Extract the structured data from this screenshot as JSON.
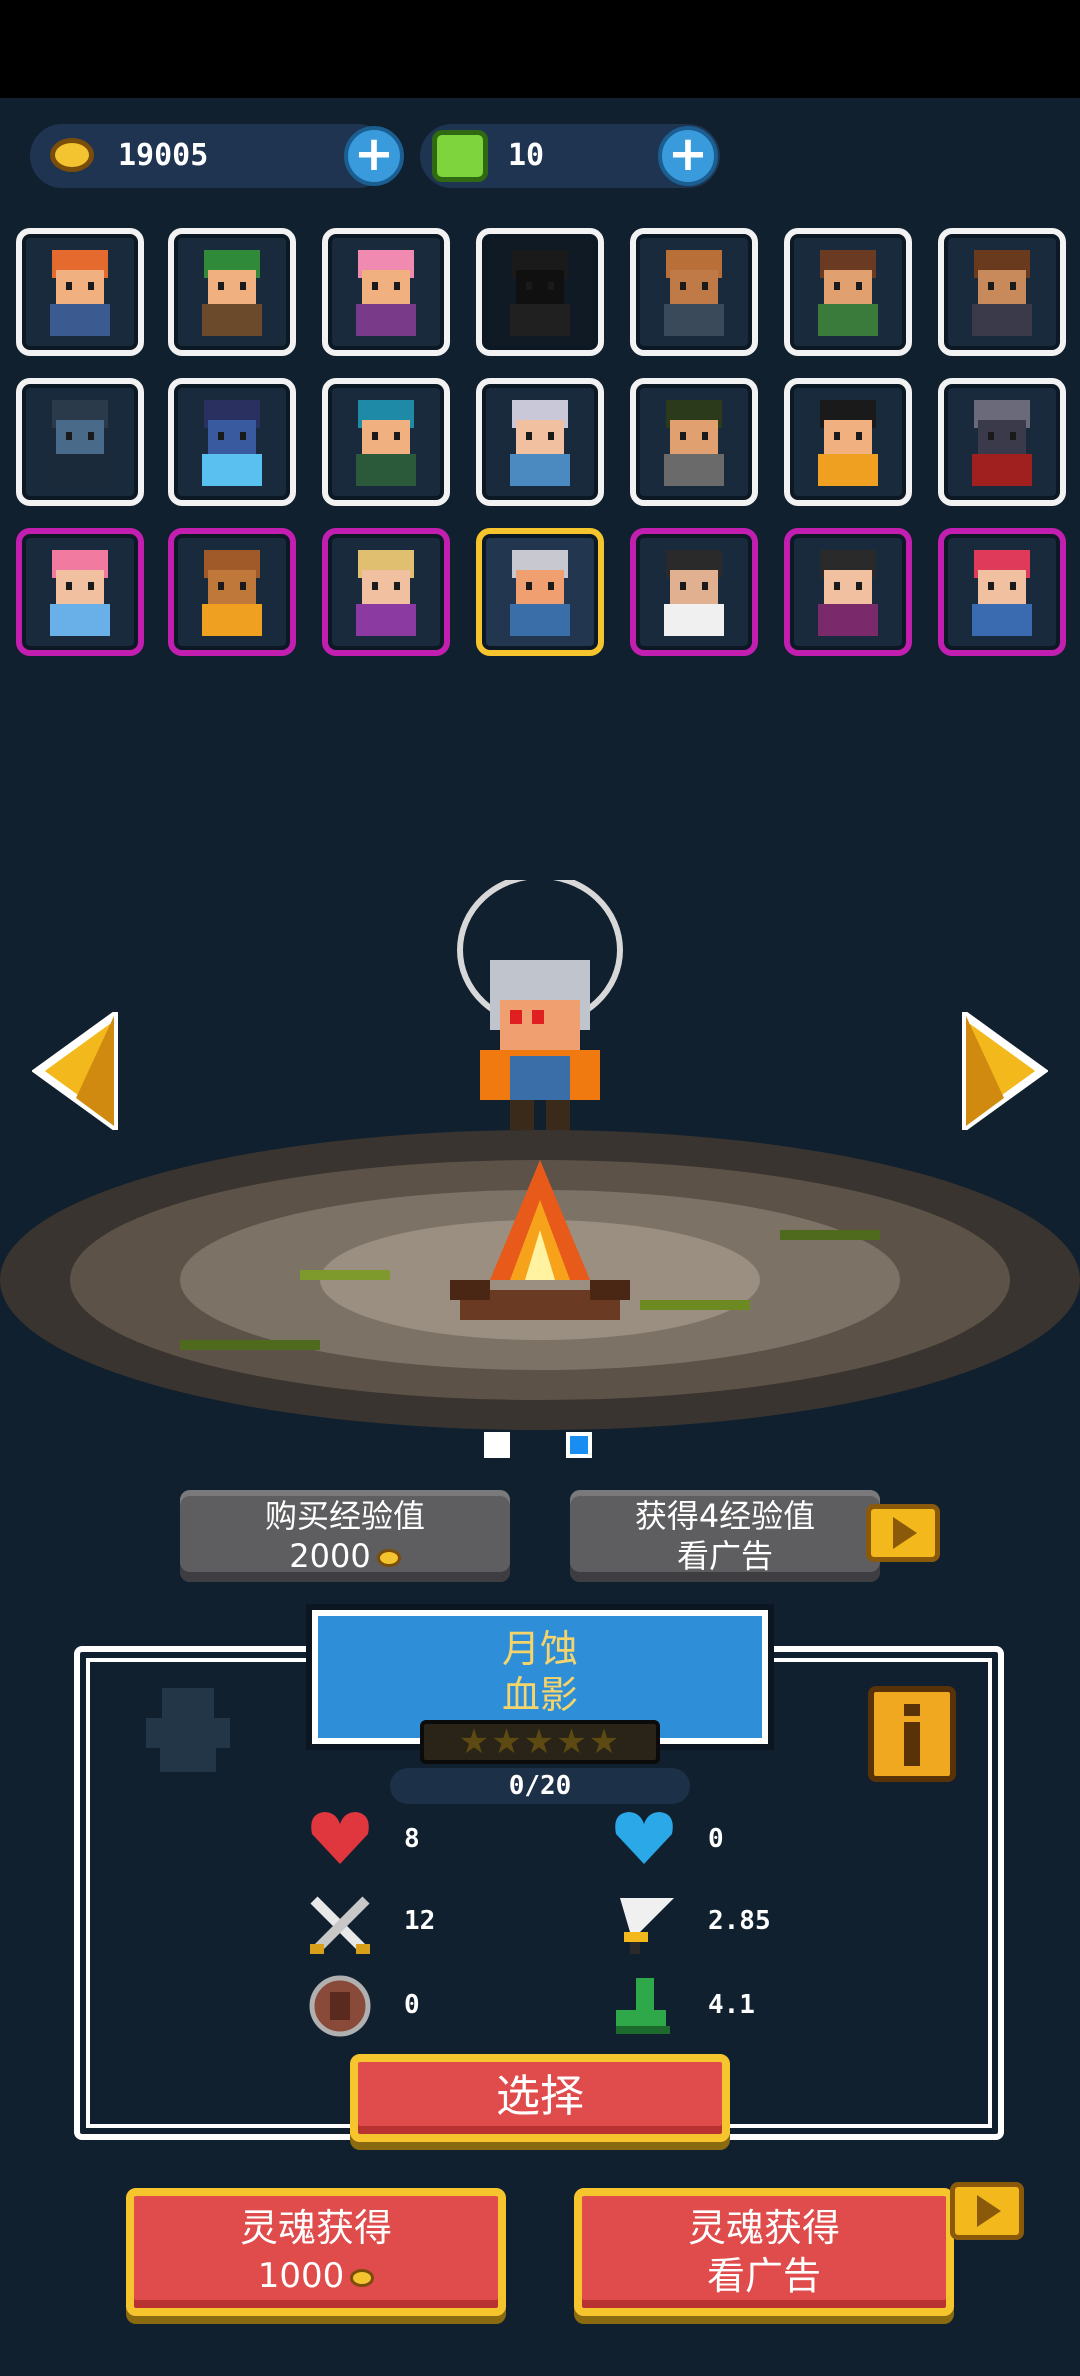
{
  "currency": {
    "gold": "19005",
    "gems": "10"
  },
  "heroes": {
    "row1": [
      "hero-red-hair",
      "hero-green-hat",
      "hero-pink-hair",
      "hero-locked-shadow",
      "hero-bald",
      "hero-bandana",
      "hero-bearded"
    ],
    "row2": [
      "hero-robot",
      "hero-dark-knight",
      "hero-blue-hair",
      "hero-silver-elf",
      "hero-headband",
      "hero-dancer",
      "hero-shark"
    ],
    "row3": [
      "hero-pink-horns",
      "hero-tiki",
      "hero-priestess",
      "hero-silver-selected",
      "hero-gunslinger",
      "hero-ninja",
      "hero-blue-twin"
    ]
  },
  "pagination": {
    "pages": 2,
    "active": 2
  },
  "buttons": {
    "buy_exp_label": "购买经验值",
    "buy_exp_price": "2000",
    "ad_exp_label": "获得4经验值",
    "ad_exp_sub": "看广告",
    "select_label": "选择",
    "soul_buy_label": "灵魂获得",
    "soul_buy_price": "1000",
    "soul_ad_label": "灵魂获得",
    "soul_ad_sub": "看广告"
  },
  "hero": {
    "name_line1": "月蚀",
    "name_line2": "血影",
    "stars": "★★★★★",
    "level": "0/20",
    "stats": {
      "hp": "8",
      "shield": "0",
      "attack": "12",
      "crit": "2.85",
      "armor": "0",
      "speed": "4.1"
    }
  },
  "colors": {
    "accent_gold": "#f6c52e",
    "red_button": "#e04b4b",
    "epic_border": "#c21fb1",
    "background": "#10202f"
  }
}
